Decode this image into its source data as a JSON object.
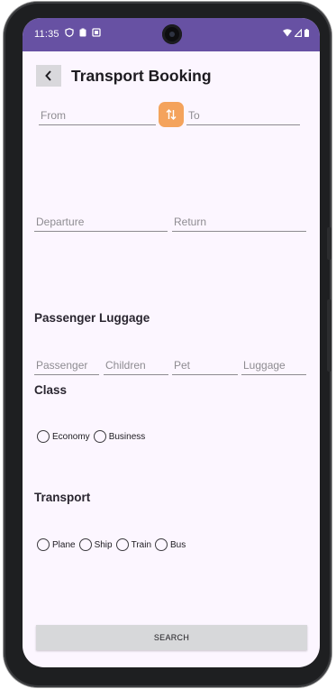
{
  "status_bar": {
    "time": "11:35",
    "bg_color": "#6751a3",
    "left_icons": [
      "shield-icon",
      "clipboard-icon",
      "notification-a-icon"
    ],
    "right_icons": [
      "wifi-icon",
      "signal-icon",
      "battery-icon"
    ]
  },
  "header": {
    "back_icon": "chevron-left-icon",
    "title": "Transport Booking"
  },
  "route": {
    "from_placeholder": "From",
    "to_placeholder": "To",
    "swap_icon": "swap-vertical-icon",
    "swap_color": "#f4a35c"
  },
  "dates": {
    "departure_placeholder": "Departure",
    "return_placeholder": "Return"
  },
  "passenger_luggage": {
    "title": "Passenger Luggage",
    "passenger_placeholder": "Passenger",
    "children_placeholder": "Children",
    "pet_placeholder": "Pet",
    "luggage_placeholder": "Luggage"
  },
  "class": {
    "title": "Class",
    "options": [
      "Economy",
      "Business"
    ],
    "selected": null
  },
  "transport": {
    "title": "Transport",
    "options": [
      "Plane",
      "Ship",
      "Train",
      "Bus"
    ],
    "selected": null
  },
  "search_label": "SEARCH"
}
